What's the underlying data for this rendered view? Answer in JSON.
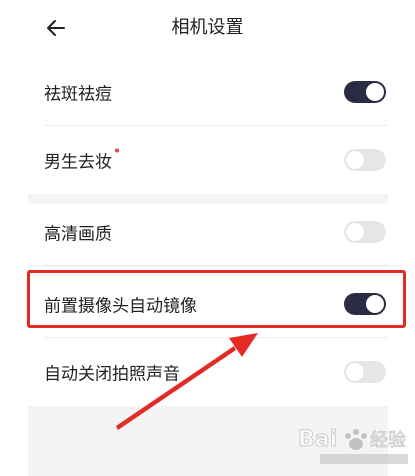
{
  "header": {
    "title": "相机设置",
    "back_icon": "arrow-left-icon"
  },
  "settings": [
    {
      "label": "祛斑祛痘",
      "enabled": true,
      "badge_dot": false
    },
    {
      "label": "男生去妆",
      "enabled": false,
      "badge_dot": true
    },
    {
      "label": "高清画质",
      "enabled": false,
      "badge_dot": false
    },
    {
      "label": "前置摄像头自动镜像",
      "enabled": true,
      "badge_dot": false
    },
    {
      "label": "自动关闭拍照声音",
      "enabled": false,
      "badge_dot": false
    }
  ],
  "colors": {
    "toggle_on": "#2a2b45",
    "toggle_off": "#e6e6e6",
    "highlight": "#e32b25",
    "badge_dot": "#e8424f"
  }
}
